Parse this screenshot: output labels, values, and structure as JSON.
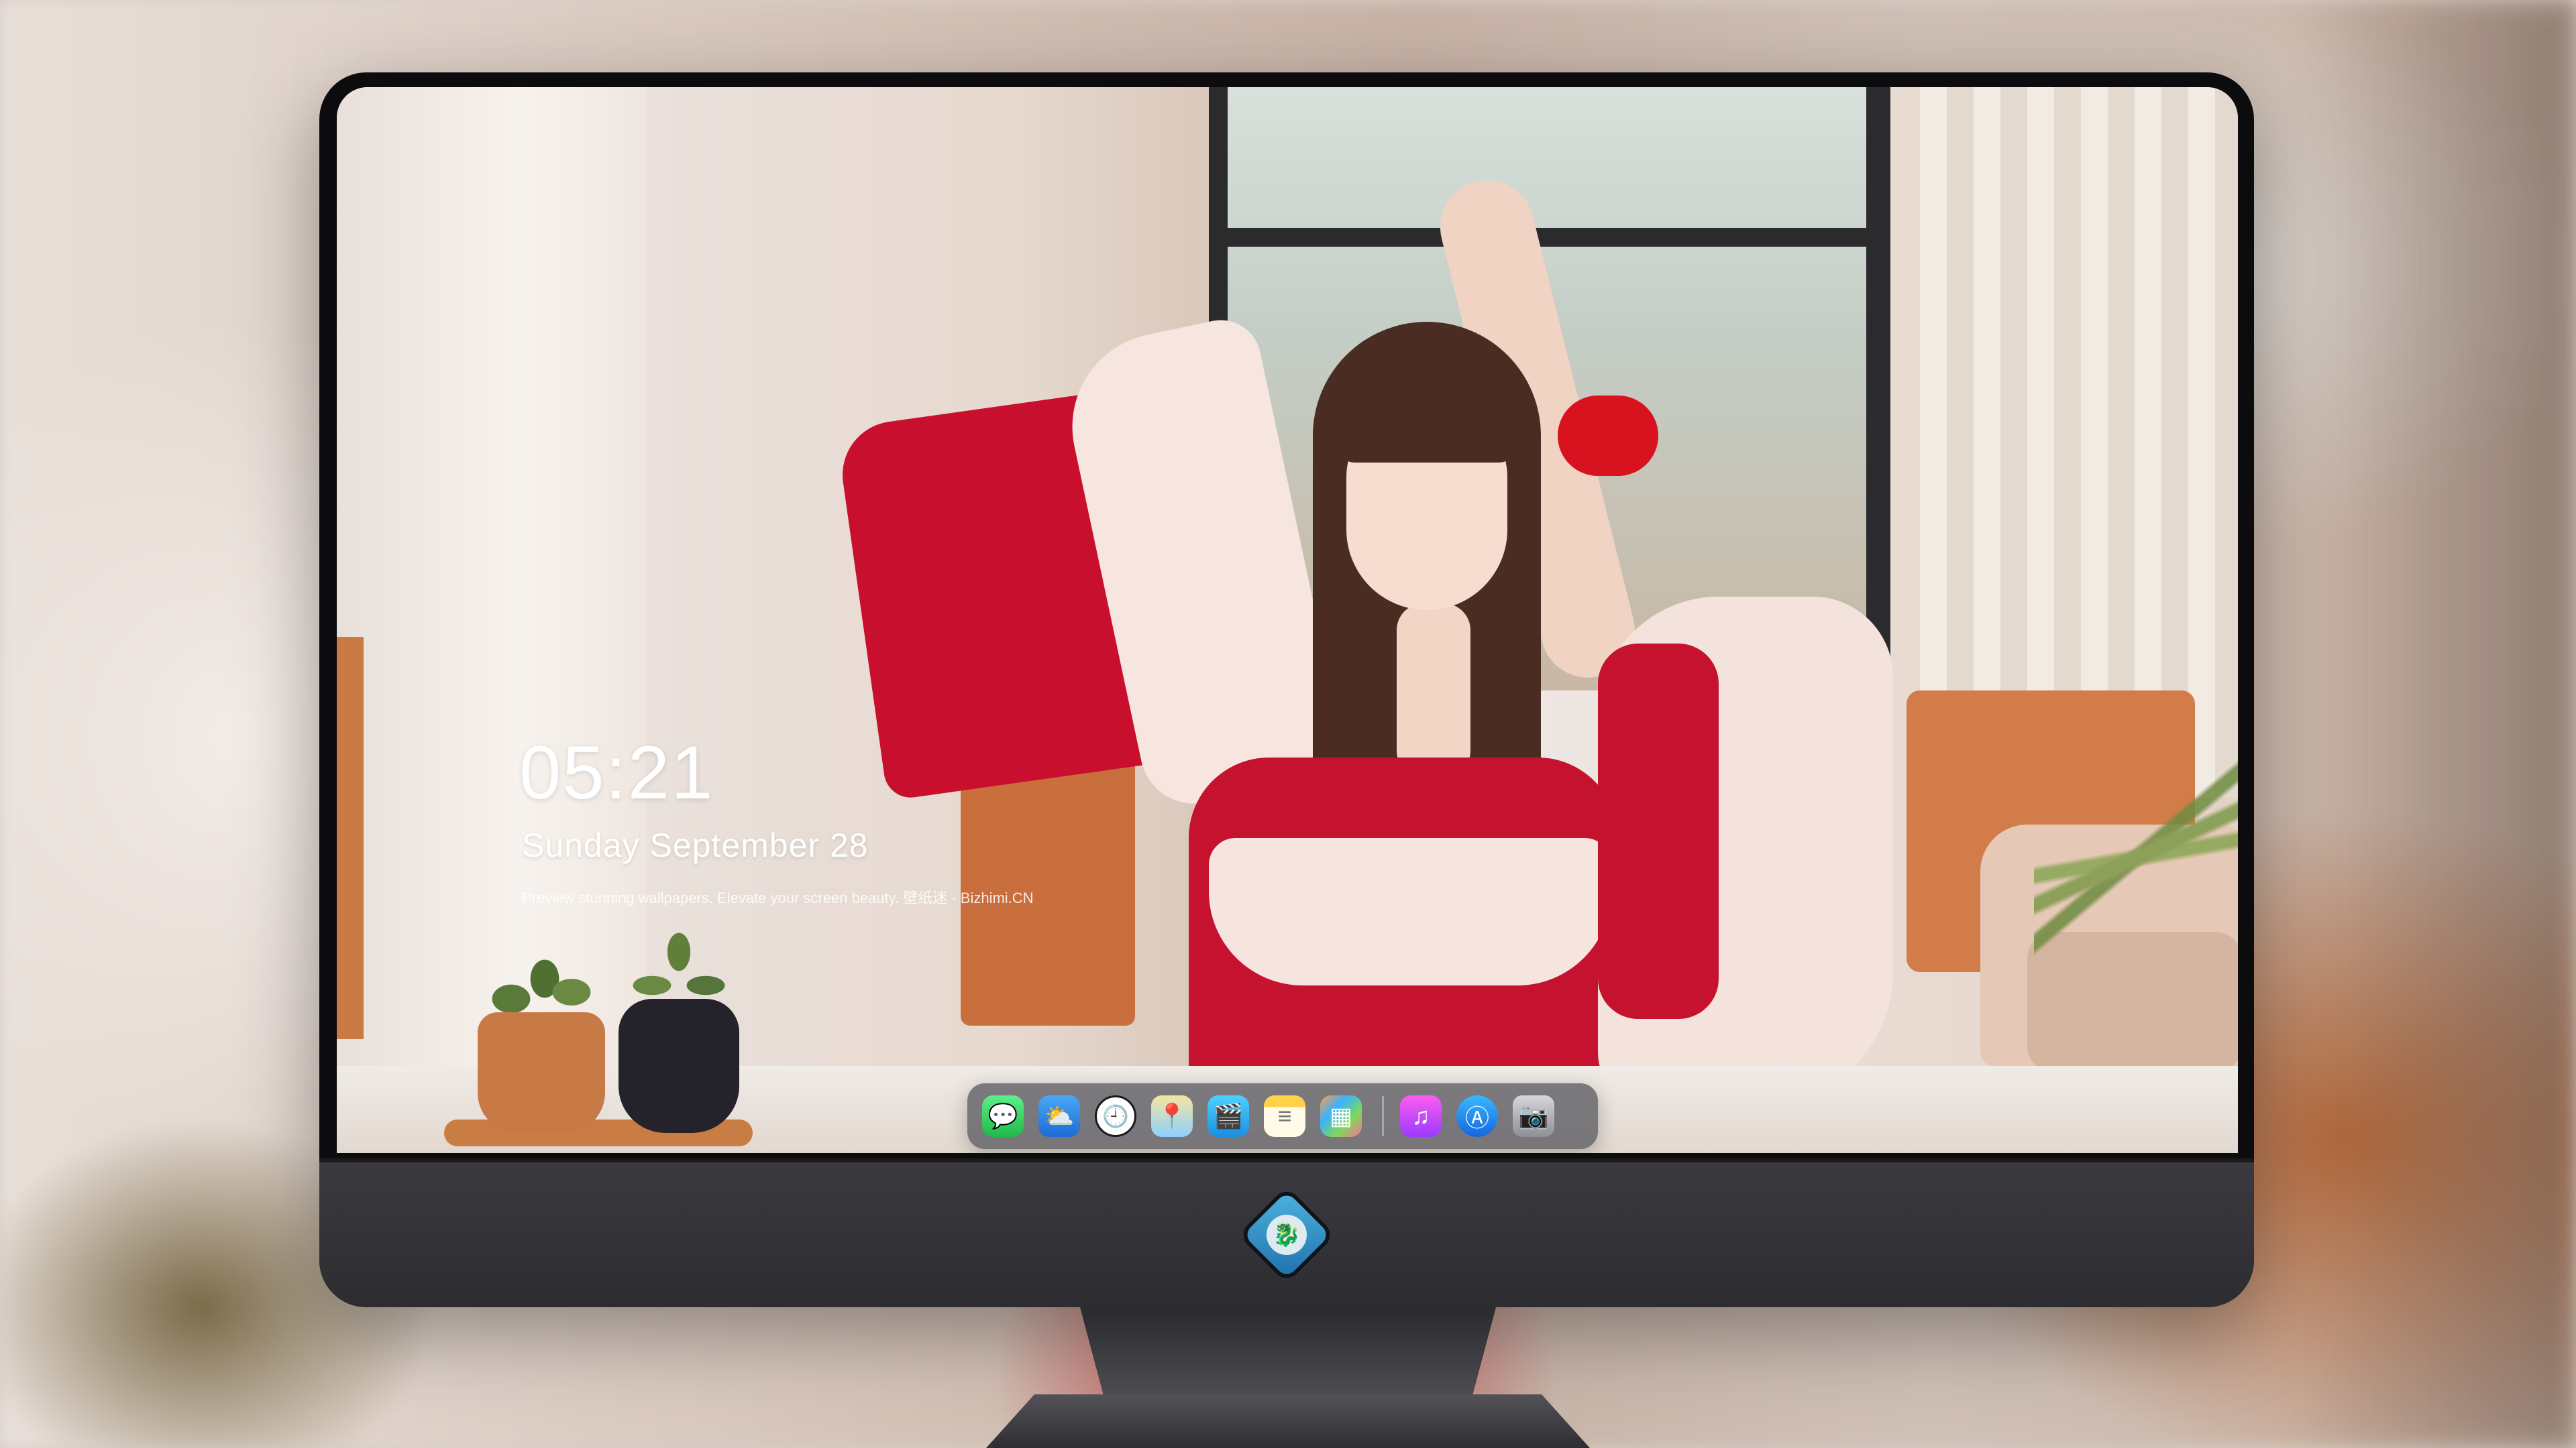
{
  "lockscreen": {
    "time": "05:21",
    "date": "Sunday September 28",
    "caption": "Preview stunning wallpapers. Elevate your screen beauty. 壁纸迷 · Bizhimi.CN"
  },
  "dock": {
    "apps": [
      {
        "name": "Messages",
        "icon": "message-bubble-icon",
        "glyph": "💬"
      },
      {
        "name": "Weather",
        "icon": "weather-cloud-icon",
        "glyph": "⛅"
      },
      {
        "name": "Clock",
        "icon": "clock-icon",
        "glyph": "🕘"
      },
      {
        "name": "Maps",
        "icon": "map-icon",
        "glyph": "📍"
      },
      {
        "name": "Clips",
        "icon": "clapperboard-icon",
        "glyph": "🎬"
      },
      {
        "name": "Notes",
        "icon": "notes-icon",
        "glyph": "≡"
      },
      {
        "name": "Photos",
        "icon": "photos-icon",
        "glyph": "▦"
      },
      {
        "name": "Music",
        "icon": "music-note-icon",
        "glyph": "♫"
      },
      {
        "name": "App Store",
        "icon": "app-store-icon",
        "glyph": "Ⓐ"
      },
      {
        "name": "Camera",
        "icon": "camera-icon",
        "glyph": "📷"
      }
    ]
  },
  "monitor": {
    "logo_icon": "dragon-badge-icon",
    "logo_glyph": "🐉"
  },
  "colors": {
    "bezel": "#0c0c0e",
    "chin": "#2d2c30",
    "dress_red": "#c5122f",
    "dock_bg": "#5a5a60"
  }
}
